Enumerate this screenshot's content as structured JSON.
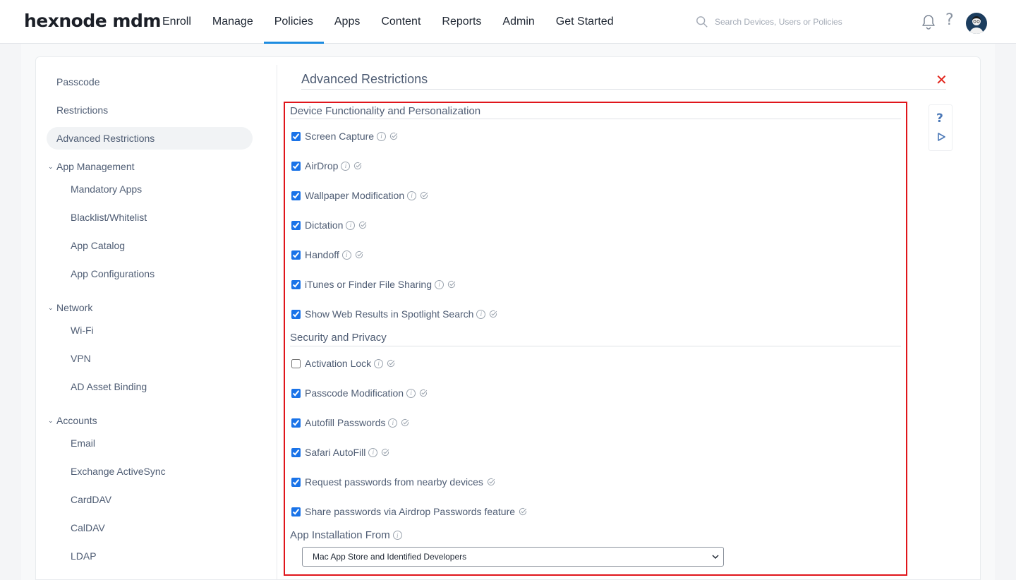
{
  "app": {
    "logo": "hexnode mdm"
  },
  "nav": {
    "items": [
      {
        "label": "Enroll"
      },
      {
        "label": "Manage"
      },
      {
        "label": "Policies",
        "active": true
      },
      {
        "label": "Apps"
      },
      {
        "label": "Content"
      },
      {
        "label": "Reports"
      },
      {
        "label": "Admin"
      },
      {
        "label": "Get Started"
      }
    ]
  },
  "search": {
    "placeholder": "Search Devices, Users or Policies",
    "value": ""
  },
  "header_icons": [
    "search-icon",
    "bell-icon",
    "help-icon",
    "avatar"
  ],
  "sidebar": {
    "items": [
      {
        "label": "Passcode"
      },
      {
        "label": "Restrictions"
      },
      {
        "label": "Advanced Restrictions",
        "active": true
      }
    ],
    "groups": [
      {
        "label": "App Management",
        "expanded": true,
        "items": [
          "Mandatory Apps",
          "Blacklist/Whitelist",
          "App Catalog",
          "App Configurations"
        ]
      },
      {
        "label": "Network",
        "expanded": true,
        "items": [
          "Wi-Fi",
          "VPN",
          "AD Asset Binding"
        ]
      },
      {
        "label": "Accounts",
        "expanded": true,
        "items": [
          "Email",
          "Exchange ActiveSync",
          "CardDAV",
          "CalDAV",
          "LDAP"
        ]
      }
    ]
  },
  "main": {
    "title": "Advanced Restrictions",
    "sections": [
      {
        "title": "Device Functionality and Personalization",
        "options": [
          {
            "label": "Screen Capture",
            "checked": true,
            "info": true
          },
          {
            "label": "AirDrop",
            "checked": true,
            "info": true
          },
          {
            "label": "Wallpaper Modification",
            "checked": true,
            "info": true
          },
          {
            "label": "Dictation",
            "checked": true,
            "info": true
          },
          {
            "label": "Handoff",
            "checked": true,
            "info": true
          },
          {
            "label": "iTunes or Finder File Sharing",
            "checked": true,
            "info": true
          },
          {
            "label": "Show Web Results in Spotlight Search",
            "checked": true,
            "info": true
          }
        ]
      },
      {
        "title": "Security and Privacy",
        "options": [
          {
            "label": "Activation Lock",
            "checked": false,
            "info": true
          },
          {
            "label": "Passcode Modification",
            "checked": true,
            "info": true
          },
          {
            "label": "Autofill Passwords",
            "checked": true,
            "info": true
          },
          {
            "label": "Safari AutoFill",
            "checked": true,
            "info": true
          },
          {
            "label": "Request passwords from nearby devices",
            "checked": true,
            "info": false
          },
          {
            "label": "Share passwords via Airdrop Passwords feature",
            "checked": true,
            "info": false
          }
        ]
      }
    ],
    "app_installation": {
      "label": "App Installation From",
      "selected": "Mac App Store and Identified Developers"
    }
  },
  "colors": {
    "accent": "#1d8ce0",
    "highlight_border": "#e0151b",
    "close": "#e2231a",
    "text": "#4f5d74"
  }
}
